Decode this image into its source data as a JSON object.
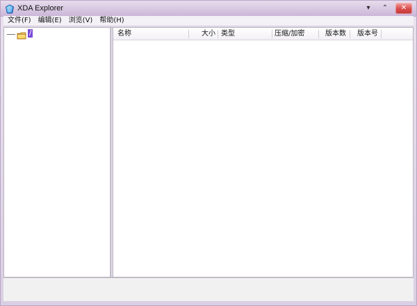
{
  "window": {
    "title": "XDA Explorer",
    "controls": {
      "minimize": "▾",
      "maximize": "⌃",
      "close": "✕"
    }
  },
  "menubar": {
    "items": [
      {
        "label": "文件(F)"
      },
      {
        "label": "编辑(E)"
      },
      {
        "label": "浏览(V)"
      },
      {
        "label": "帮助(H)"
      }
    ]
  },
  "tree": {
    "root_label": "/"
  },
  "list": {
    "columns": [
      {
        "label": "名称"
      },
      {
        "label": "大小"
      },
      {
        "label": "类型"
      },
      {
        "label": "压缩/加密"
      },
      {
        "label": "版本数"
      },
      {
        "label": "版本号"
      }
    ]
  },
  "colors": {
    "selection": "#7a4bd6",
    "close_button": "#d94b4b"
  },
  "icons": {
    "app": "xda-app-icon",
    "folder": "folder-icon"
  }
}
